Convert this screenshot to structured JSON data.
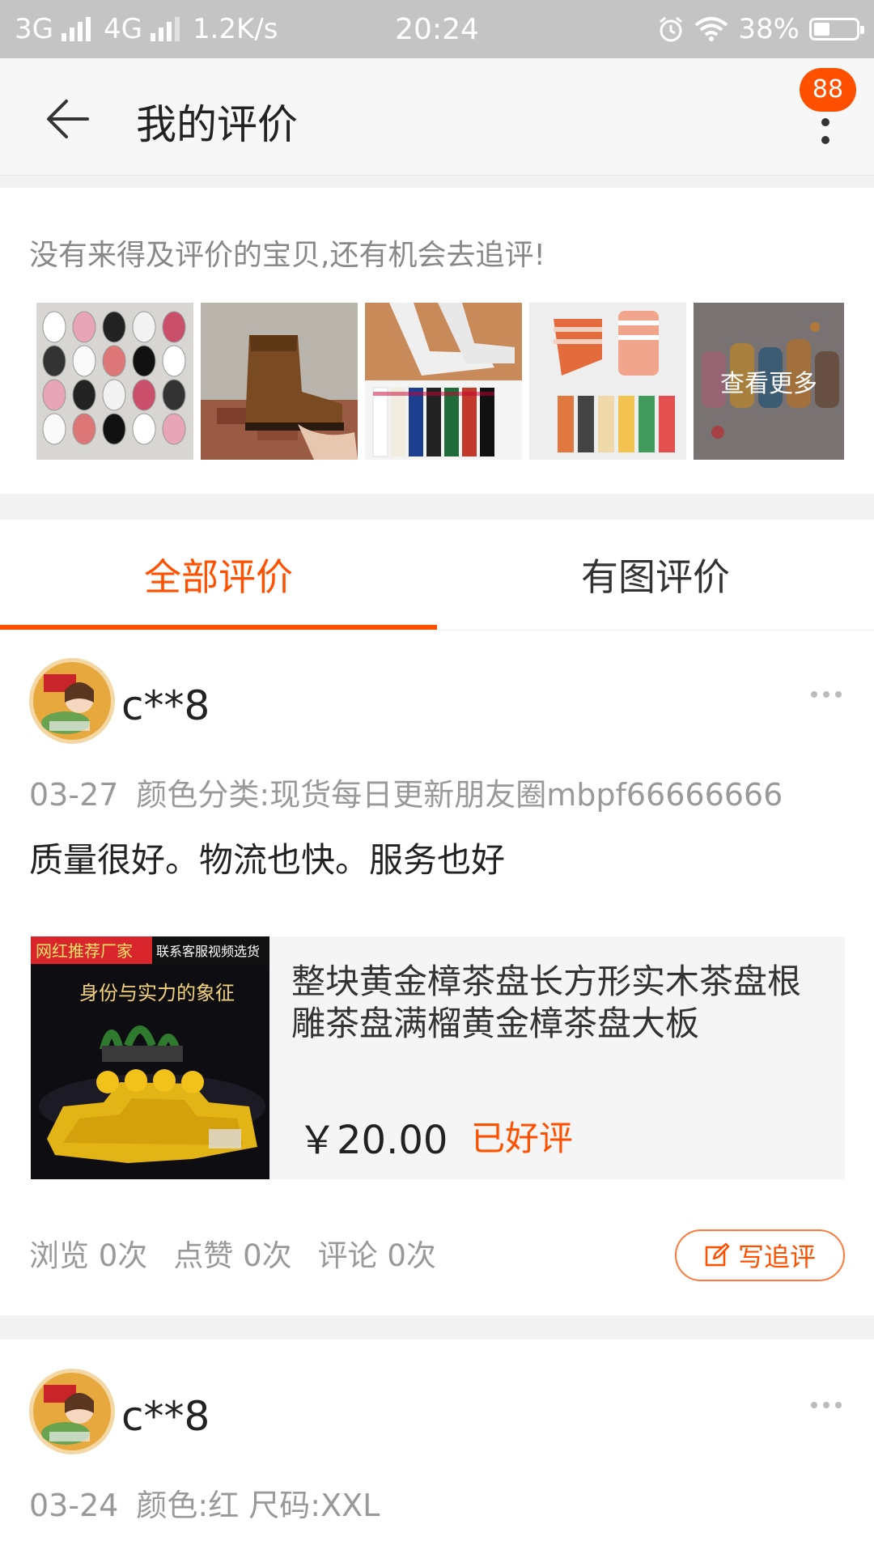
{
  "status_bar": {
    "network1": "3G",
    "network2": "4G",
    "speed": "1.2K/s",
    "time": "20:24",
    "battery_text": "38%",
    "battery_level": 0.38
  },
  "header": {
    "title": "我的评价",
    "badge": "88"
  },
  "pending": {
    "hint": "没有来得及评价的宝贝,还有机会去追评!",
    "see_more": "查看更多",
    "thumbnails": [
      "sneakers-photo",
      "boot-photo",
      "socks-photo",
      "striped-socks-photo",
      "colorful-socks-photo"
    ]
  },
  "tabs": [
    {
      "label": "全部评价",
      "active": true
    },
    {
      "label": "有图评价",
      "active": false
    }
  ],
  "reviews": [
    {
      "user": "c**8",
      "date": "03-27",
      "variant": "颜色分类:现货每日更新朋友圈mbpf66666666",
      "content": "质量很好。物流也快。服务也好",
      "product": {
        "name": "整块黄金樟茶盘长方形实木茶盘根雕茶盘满榴黄金樟茶盘大板",
        "price": "￥20.00",
        "status": "已好评",
        "image_tag": "网红推荐厂家",
        "image_tag2": "联系客服视频选货",
        "image_slogan": "身份与实力的象征"
      },
      "stats": {
        "views": "浏览 0次",
        "likes": "点赞 0次",
        "comments": "评论 0次"
      },
      "followup_label": "写追评"
    },
    {
      "user": "c**8",
      "date": "03-24",
      "variant": "颜色:红 尺码:XXL",
      "content": ""
    }
  ],
  "colors": {
    "accent": "#ff5000",
    "statusbar": "#c4c4c4"
  }
}
